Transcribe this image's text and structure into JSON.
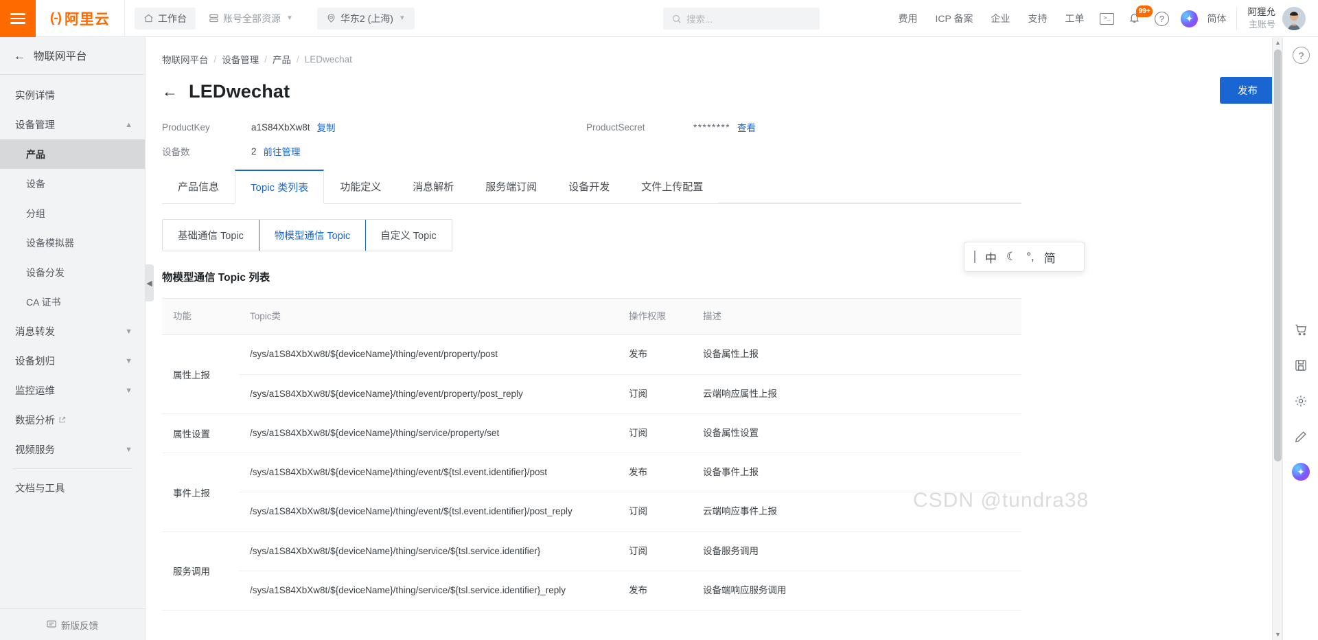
{
  "header": {
    "menu_icon": "hamburger-icon",
    "logo_text": "阿里云",
    "workbench": "工作台",
    "resources": "账号全部资源",
    "region": "华东2 (上海)",
    "search_placeholder": "搜索...",
    "nav_links": [
      "费用",
      "ICP 备案",
      "企业",
      "支持",
      "工单"
    ],
    "terminal_icon": "terminal-icon",
    "notification_badge": "99+",
    "help_icon": "help-circle-icon",
    "ai_icon": "ai-assistant-icon",
    "language": "简体",
    "account_name": "阿狸允",
    "account_type": "主账号",
    "accent_orange": "#ff6a00",
    "accent_blue": "#1966d2"
  },
  "sidebar": {
    "title": "物联网平台",
    "back_icon": "arrow-left-icon",
    "items": [
      {
        "label": "实例详情",
        "level": 0,
        "expandable": false,
        "active": false
      },
      {
        "label": "设备管理",
        "level": 0,
        "expandable": true,
        "expanded": true,
        "active": false
      },
      {
        "label": "产品",
        "level": 1,
        "expandable": false,
        "active": true
      },
      {
        "label": "设备",
        "level": 1,
        "expandable": false,
        "active": false
      },
      {
        "label": "分组",
        "level": 1,
        "expandable": false,
        "active": false
      },
      {
        "label": "设备模拟器",
        "level": 1,
        "expandable": false,
        "active": false
      },
      {
        "label": "设备分发",
        "level": 1,
        "expandable": false,
        "active": false
      },
      {
        "label": "CA 证书",
        "level": 1,
        "expandable": false,
        "active": false
      },
      {
        "label": "消息转发",
        "level": 0,
        "expandable": true,
        "expanded": false,
        "active": false
      },
      {
        "label": "设备划归",
        "level": 0,
        "expandable": true,
        "expanded": false,
        "active": false
      },
      {
        "label": "监控运维",
        "level": 0,
        "expandable": true,
        "expanded": false,
        "active": false
      },
      {
        "label": "数据分析",
        "level": 0,
        "expandable": false,
        "external": true,
        "active": false
      },
      {
        "label": "视频服务",
        "level": 0,
        "expandable": true,
        "expanded": false,
        "active": false
      },
      {
        "label": "文档与工具",
        "level": 0,
        "expandable": false,
        "active": false,
        "after_divider": true
      }
    ],
    "footer": "新版反馈",
    "footer_icon": "feedback-icon",
    "collapse_icon": "chevron-left-icon"
  },
  "breadcrumb": {
    "items": [
      "物联网平台",
      "设备管理",
      "产品",
      "LEDwechat"
    ],
    "separator": "/"
  },
  "page": {
    "back_icon": "arrow-left-icon",
    "title": "LEDwechat",
    "publish_button": "发布"
  },
  "meta": {
    "product_key_label": "ProductKey",
    "product_key_value": "a1S84XbXw8t",
    "product_key_action": "复制",
    "device_count_label": "设备数",
    "device_count_value": "2",
    "device_count_action": "前往管理",
    "product_secret_label": "ProductSecret",
    "product_secret_value": "********",
    "product_secret_action": "查看"
  },
  "tabs": [
    {
      "label": "产品信息",
      "active": false
    },
    {
      "label": "Topic 类列表",
      "active": true
    },
    {
      "label": "功能定义",
      "active": false
    },
    {
      "label": "消息解析",
      "active": false
    },
    {
      "label": "服务端订阅",
      "active": false
    },
    {
      "label": "设备开发",
      "active": false
    },
    {
      "label": "文件上传配置",
      "active": false
    }
  ],
  "subtabs": [
    {
      "label": "基础通信 Topic",
      "active": false
    },
    {
      "label": "物模型通信 Topic",
      "active": true
    },
    {
      "label": "自定义 Topic",
      "active": false
    }
  ],
  "section": {
    "title": "物模型通信 Topic 列表"
  },
  "table": {
    "columns": [
      "功能",
      "Topic类",
      "操作权限",
      "描述"
    ],
    "groups": [
      {
        "func": "属性上报",
        "rows": [
          {
            "topic": "/sys/a1S84XbXw8t/${deviceName}/thing/event/property/post",
            "perm": "发布",
            "desc": "设备属性上报"
          },
          {
            "topic": "/sys/a1S84XbXw8t/${deviceName}/thing/event/property/post_reply",
            "perm": "订阅",
            "desc": "云端响应属性上报"
          }
        ]
      },
      {
        "func": "属性设置",
        "rows": [
          {
            "topic": "/sys/a1S84XbXw8t/${deviceName}/thing/service/property/set",
            "perm": "订阅",
            "desc": "设备属性设置"
          }
        ]
      },
      {
        "func": "事件上报",
        "rows": [
          {
            "topic": "/sys/a1S84XbXw8t/${deviceName}/thing/event/${tsl.event.identifier}/post",
            "perm": "发布",
            "desc": "设备事件上报"
          },
          {
            "topic": "/sys/a1S84XbXw8t/${deviceName}/thing/event/${tsl.event.identifier}/post_reply",
            "perm": "订阅",
            "desc": "云端响应事件上报"
          }
        ]
      },
      {
        "func": "服务调用",
        "rows": [
          {
            "topic": "/sys/a1S84XbXw8t/${deviceName}/thing/service/${tsl.service.identifier}",
            "perm": "订阅",
            "desc": "设备服务调用"
          },
          {
            "topic": "/sys/a1S84XbXw8t/${deviceName}/thing/service/${tsl.service.identifier}_reply",
            "perm": "发布",
            "desc": "设备端响应服务调用"
          }
        ]
      }
    ]
  },
  "right_rail": {
    "help_icon": "help-circle-icon",
    "buttons": [
      {
        "icon": "cart-icon"
      },
      {
        "icon": "save-icon"
      },
      {
        "icon": "gear-icon"
      },
      {
        "icon": "pencil-icon"
      },
      {
        "icon": "cloud-icon"
      }
    ],
    "ai_icon": "ai-assistant-icon"
  },
  "ime": {
    "items": [
      "中",
      "☾",
      "°,",
      "简"
    ]
  },
  "watermark": "CSDN @tundra38"
}
